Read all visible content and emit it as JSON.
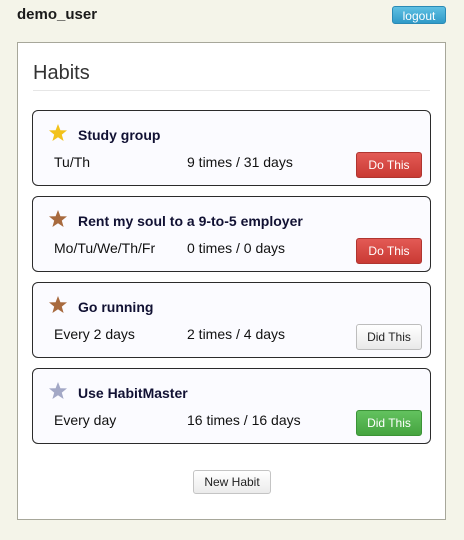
{
  "header": {
    "username": "demo_user",
    "logout_label": "logout"
  },
  "panel": {
    "title": "Habits",
    "new_habit_label": "New Habit"
  },
  "habits": [
    {
      "name": "Study group",
      "schedule": "Tu/Th",
      "stats": "9 times / 31 days",
      "button_label": "Do This",
      "button_state": "do",
      "star_color": "#f2c21b"
    },
    {
      "name": "Rent my soul to a 9-to-5 employer",
      "schedule": "Mo/Tu/We/Th/Fr",
      "stats": "0 times / 0 days",
      "button_label": "Do This",
      "button_state": "do",
      "star_color": "#a86a3e"
    },
    {
      "name": "Go running",
      "schedule": "Every 2 days",
      "stats": "2 times / 4 days",
      "button_label": "Did This",
      "button_state": "did",
      "star_color": "#a86a3e"
    },
    {
      "name": "Use HabitMaster",
      "schedule": "Every day",
      "stats": "16 times / 16 days",
      "button_label": "Did This",
      "button_state": "did-green",
      "star_color": "#a3a8c6"
    }
  ]
}
